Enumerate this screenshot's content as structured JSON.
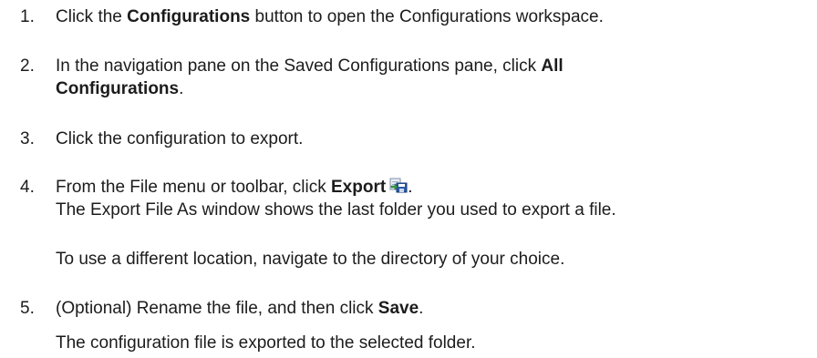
{
  "steps": [
    {
      "number": "1.",
      "pre": "Click the ",
      "bold": "Configurations",
      "post": " button to open the Configurations workspace."
    },
    {
      "number": "2.",
      "line1_pre": "In the navigation pane on the Saved Configurations pane, click ",
      "line1_bold": "All",
      "line2_bold": "Configurations",
      "line2_post": "."
    },
    {
      "number": "3.",
      "text": "Click the configuration to export."
    },
    {
      "number": "4.",
      "pre": "From the File menu or toolbar, click ",
      "bold": "Export",
      "post": ".",
      "icon": "export-file-icon",
      "line2": "The Export File As window shows the last folder you used to export a file.",
      "note": "To use a different location, navigate to the directory of your choice."
    },
    {
      "number": "5.",
      "pre": "(Optional) Rename the file, and then click ",
      "bold": "Save",
      "post": ".",
      "note": "The configuration file is exported to the selected folder."
    }
  ]
}
